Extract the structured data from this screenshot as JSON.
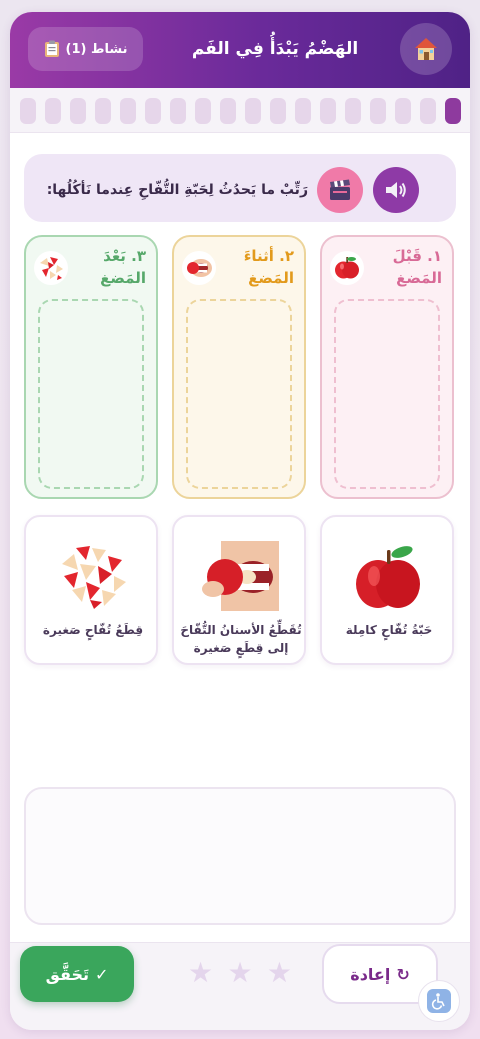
{
  "header": {
    "title": "الهَضْمُ يَبْدَأُ فِي الفَم",
    "activity_label": "نشاط (1)",
    "home_icon": "house-icon",
    "activity_icon": "clipboard-icon"
  },
  "progress": {
    "total_steps": 18,
    "current_step": 1,
    "active_color": "#8e3a9e",
    "inactive_color": "#e6d6ea"
  },
  "prompt": {
    "text": "رَتِّبْ ما يَحدُثُ لِحَبّةِ التُّفّاحِ عِندما نَأكُلُها:",
    "audio_icon": "speaker-icon",
    "video_icon": "clapperboard-icon"
  },
  "columns": [
    {
      "label": "١. قَبْلَ المَضغ",
      "icon": "apple-icon",
      "color": "#d86a96"
    },
    {
      "label": "٢. أثناءَ المَضغ",
      "icon": "biting-mouth-icon",
      "color": "#e29a1c"
    },
    {
      "label": "٣. بَعْدَ المَضغ",
      "icon": "apple-pieces-icon",
      "color": "#56a86a"
    }
  ],
  "cards": [
    {
      "label": "حَبّةُ تُفّاحٍ كامِلة",
      "image": "whole-apple-image"
    },
    {
      "label": "تُقَطِّعُ الأسنانُ التُّفّاحَ إلى قِطَعٍ صَغيرة",
      "image": "teeth-biting-apple-image"
    },
    {
      "label": "قِطَعُ تُفّاحٍ صَغيرة",
      "image": "apple-pieces-image"
    }
  ],
  "footer": {
    "reset_label": "إعادة",
    "reset_icon": "↻",
    "check_label": "تَحَقَّق",
    "check_icon": "✓",
    "stars_total": 3,
    "stars_earned": 0,
    "accessibility_icon": "wheelchair-icon"
  },
  "colors": {
    "header_start": "#9a3aa6",
    "header_end": "#4f2286",
    "check_green": "#3aa65c"
  }
}
